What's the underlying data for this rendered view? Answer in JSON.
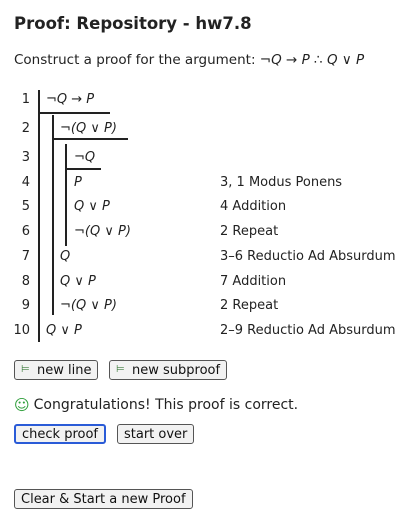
{
  "title": "Proof: Repository - hw7.8",
  "prompt": {
    "prefix": "Construct a proof for the argument: ",
    "argument": "¬Q → P ∴ Q ∨ P"
  },
  "lines": [
    {
      "num": "1",
      "formula": "¬Q → P",
      "justification": ""
    },
    {
      "num": "2",
      "formula": "¬(Q ∨ P)",
      "justification": ""
    },
    {
      "num": "3",
      "formula": "¬Q",
      "justification": ""
    },
    {
      "num": "4",
      "formula": "P",
      "justification": "3, 1 Modus Ponens"
    },
    {
      "num": "5",
      "formula": "Q ∨ P",
      "justification": "4 Addition"
    },
    {
      "num": "6",
      "formula": "¬(Q ∨ P)",
      "justification": "2 Repeat"
    },
    {
      "num": "7",
      "formula": "Q",
      "justification": "3–6 Reductio Ad Absurdum"
    },
    {
      "num": "8",
      "formula": "Q ∨ P",
      "justification": "7 Addition"
    },
    {
      "num": "9",
      "formula": "¬(Q ∨ P)",
      "justification": "2 Repeat"
    },
    {
      "num": "10",
      "formula": "Q ∨ P",
      "justification": "2–9 Reductio Ad Absurdum"
    }
  ],
  "buttons": {
    "new_line": "new line",
    "new_subproof": "new subproof",
    "check_proof": "check proof",
    "start_over": "start over",
    "clear_new": "Clear & Start a new Proof"
  },
  "status": "Congratulations! This proof is correct.",
  "icons": {
    "new_line": "add-line-icon",
    "new_subproof": "add-subproof-icon",
    "status": "smiley-icon"
  },
  "colors": {
    "success": "#2e9e3a",
    "focus_border": "#2a5bd7"
  }
}
